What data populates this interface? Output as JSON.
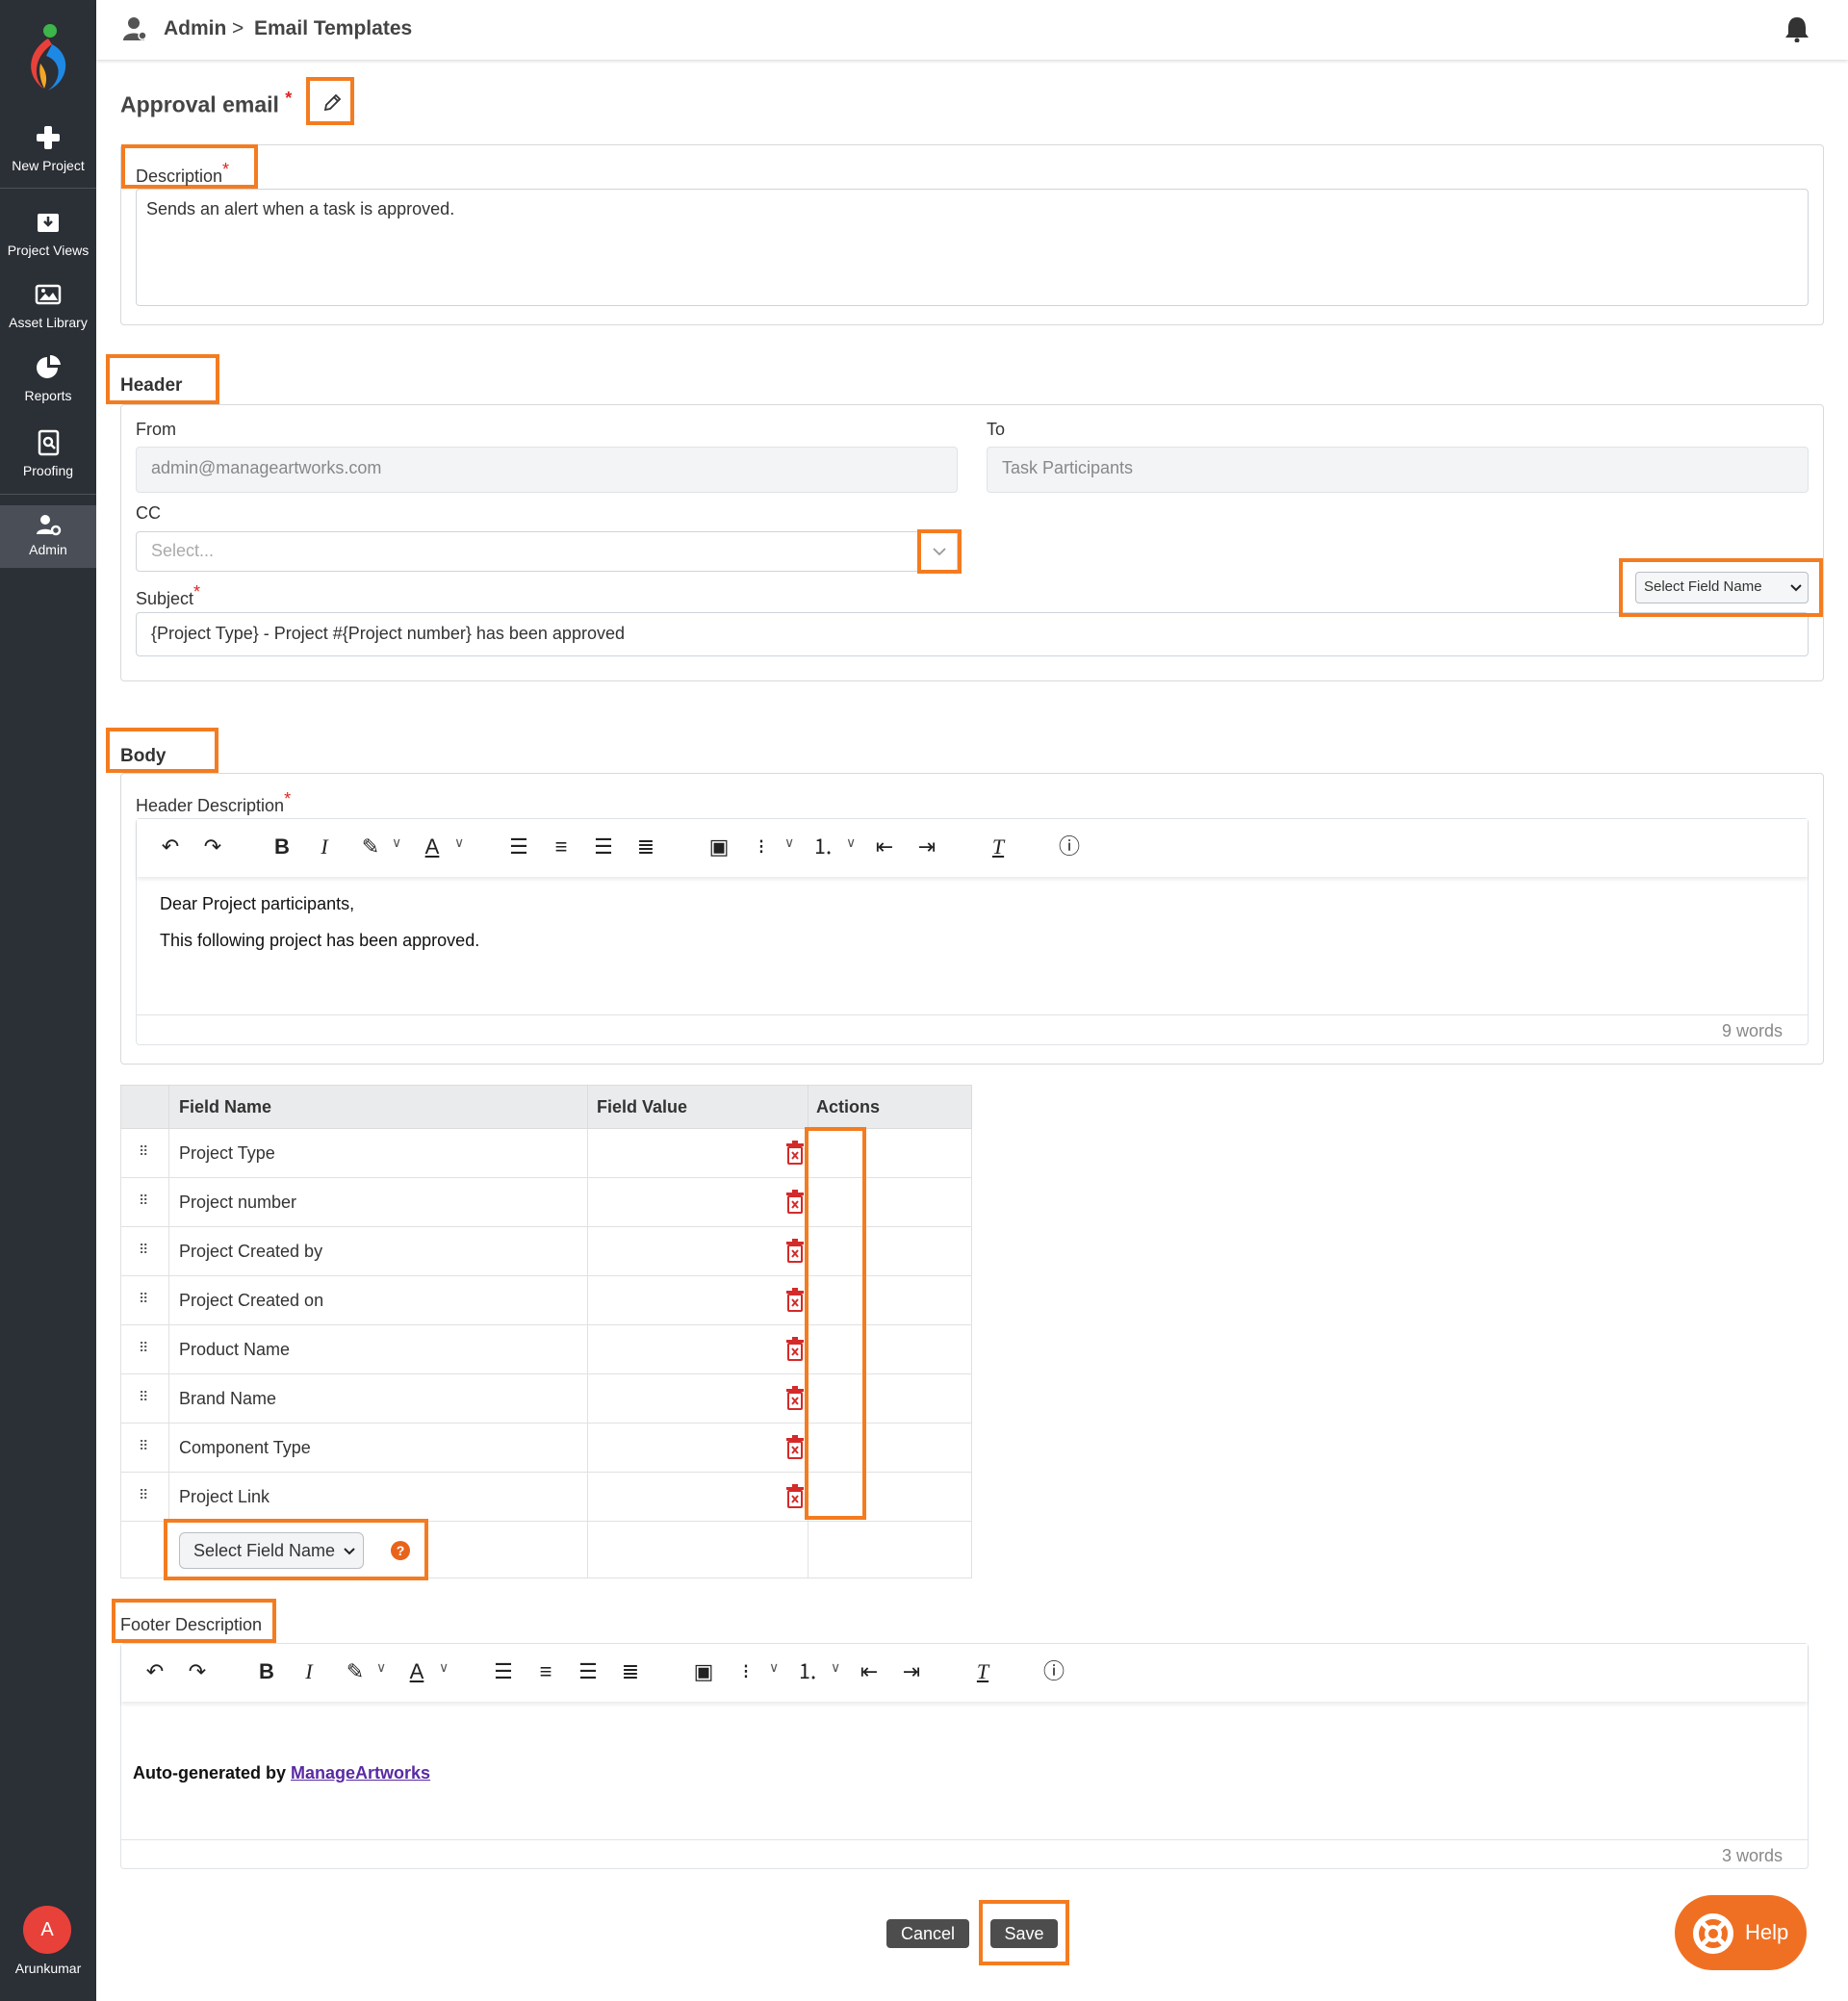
{
  "sidebar": {
    "items": [
      {
        "label": "New Project",
        "icon": "plus-icon"
      },
      {
        "label": "Project Views",
        "icon": "tray-download-icon"
      },
      {
        "label": "Asset Library",
        "icon": "image-icon"
      },
      {
        "label": "Reports",
        "icon": "pie-chart-icon"
      },
      {
        "label": "Proofing",
        "icon": "document-search-icon"
      },
      {
        "label": "Admin",
        "icon": "user-gear-icon"
      }
    ],
    "user": {
      "initial": "A",
      "name": "Arunkumar"
    }
  },
  "breadcrumb": {
    "root": "Admin",
    "separator": ">",
    "current": "Email Templates"
  },
  "page": {
    "title": "Approval email",
    "required_mark": "*"
  },
  "description": {
    "label": "Description",
    "required_mark": "*",
    "value": "Sends an alert when a task is approved."
  },
  "header_section": {
    "heading": "Header",
    "from_label": "From",
    "from_value": "admin@manageartworks.com",
    "to_label": "To",
    "to_value": "Task Participants",
    "cc_label": "CC",
    "cc_placeholder": "Select...",
    "subject_label": "Subject",
    "subject_required": "*",
    "subject_value": "{Project Type} - Project #{Project number} has been approved",
    "field_select_label": "Select Field Name"
  },
  "body_section": {
    "heading": "Body",
    "header_desc_label": "Header Description",
    "header_desc_required": "*",
    "editor_lines": [
      "Dear Project participants,",
      "This following project has been approved."
    ],
    "word_count": "9 words"
  },
  "fields_table": {
    "columns": [
      "Field Name",
      "Field Value",
      "Actions"
    ],
    "rows": [
      {
        "name": "Project Type",
        "value": ""
      },
      {
        "name": "Project number",
        "value": ""
      },
      {
        "name": "Project Created by",
        "value": ""
      },
      {
        "name": "Project Created on",
        "value": ""
      },
      {
        "name": "Product Name",
        "value": ""
      },
      {
        "name": "Brand Name",
        "value": ""
      },
      {
        "name": "Component Type",
        "value": ""
      },
      {
        "name": "Project Link",
        "value": ""
      }
    ],
    "add_select_label": "Select Field Name",
    "help_mark": "?"
  },
  "footer_section": {
    "label": "Footer Description",
    "prefix": "Auto-generated by",
    "link_text": "ManageArtworks",
    "word_count": "3 words"
  },
  "actions": {
    "cancel": "Cancel",
    "save": "Save",
    "help": "Help"
  },
  "colors": {
    "highlight": "#f47c20",
    "sidebar": "#2b2f36",
    "accent": "#f07023",
    "required": "#e02424",
    "trash": "#d42a2a"
  }
}
